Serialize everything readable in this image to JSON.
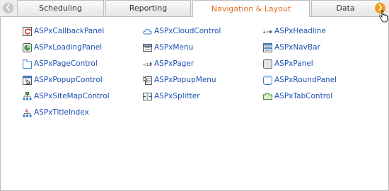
{
  "tabs": [
    {
      "label": "Scheduling",
      "active": false
    },
    {
      "label": "Reporting",
      "active": false
    },
    {
      "label": "Navigation & Layout",
      "active": true
    },
    {
      "label": "Data",
      "active": false
    }
  ],
  "items": [
    {
      "label": "ASPxCallbackPanel",
      "icon": "callback-panel-icon"
    },
    {
      "label": "ASPxCloudControl",
      "icon": "cloud-icon"
    },
    {
      "label": "ASPxHeadline",
      "icon": "headline-icon"
    },
    {
      "label": "ASPxLoadingPanel",
      "icon": "loading-panel-icon"
    },
    {
      "label": "ASPxMenu",
      "icon": "menu-icon"
    },
    {
      "label": "ASPxNavBar",
      "icon": "navbar-icon"
    },
    {
      "label": "ASPxPageControl",
      "icon": "page-control-icon"
    },
    {
      "label": "ASPxPager",
      "icon": "pager-icon"
    },
    {
      "label": "ASPxPanel",
      "icon": "panel-icon"
    },
    {
      "label": "ASPxPopupControl",
      "icon": "popup-control-icon"
    },
    {
      "label": "ASPxPopupMenu",
      "icon": "popup-menu-icon"
    },
    {
      "label": "ASPxRoundPanel",
      "icon": "round-panel-icon"
    },
    {
      "label": "ASPxSiteMapControl",
      "icon": "sitemap-icon"
    },
    {
      "label": "ASPxSplitter",
      "icon": "splitter-icon"
    },
    {
      "label": "ASPxTabControl",
      "icon": "tab-control-icon"
    },
    {
      "label": "ASPxTitleIndex",
      "icon": "title-index-icon"
    }
  ],
  "colors": {
    "active_tab_text": "#e06b1c",
    "link": "#1f4fb3",
    "scroll_right": "#f29a1a"
  }
}
